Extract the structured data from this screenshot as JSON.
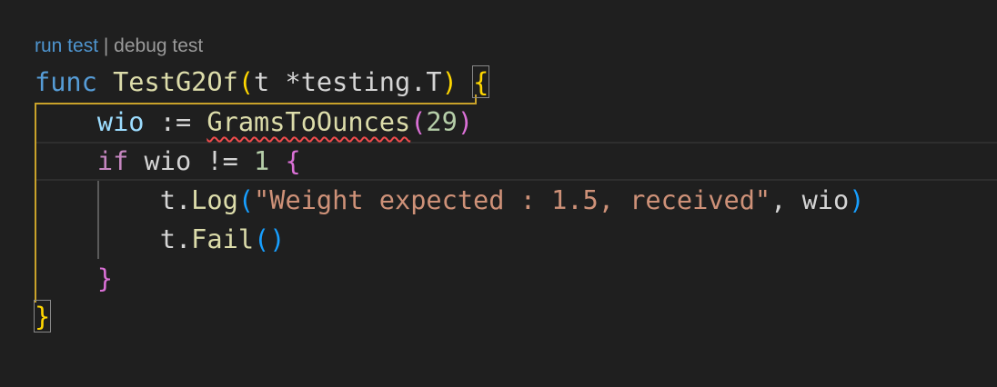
{
  "codelens": {
    "run": "run test",
    "separator": " | ",
    "debug": "debug test"
  },
  "code": {
    "line1": {
      "kw_func": "func",
      "fn_name": "TestG2Of",
      "open_paren": "(",
      "param": "t *testing.T",
      "close_paren": ")",
      "open_brace": "{"
    },
    "line2": {
      "indent": "    ",
      "var": "wio",
      "op": " := ",
      "call": "GramsToOunces",
      "open_paren": "(",
      "arg": "29",
      "close_paren": ")"
    },
    "line3": {
      "indent": "    ",
      "kw_if": "if",
      "cond": " wio != ",
      "num": "1",
      "space": " ",
      "open_brace": "{"
    },
    "line4": {
      "indent": "        ",
      "obj": "t.",
      "method": "Log",
      "open_paren": "(",
      "str": "\"Weight expected : 1.5, received\"",
      "rest": ", wio",
      "close_paren": ")"
    },
    "line5": {
      "indent": "        ",
      "obj": "t.",
      "method": "Fail",
      "parens": "()"
    },
    "line6": {
      "indent": "    ",
      "close_brace": "}"
    },
    "line7": {
      "close_brace": "}"
    }
  },
  "colors": {
    "background": "#1f1f1f",
    "keyword": "#569cd6",
    "control": "#c586c0",
    "function": "#dcdcaa",
    "variable": "#9cdcfe",
    "number": "#b5cea8",
    "string": "#ce9178",
    "bracket_level1": "#ffd700",
    "bracket_level2": "#da70d6",
    "bracket_level3": "#179fff",
    "error_squiggle": "#f14c4c",
    "codelens_link": "#4e94ce"
  }
}
